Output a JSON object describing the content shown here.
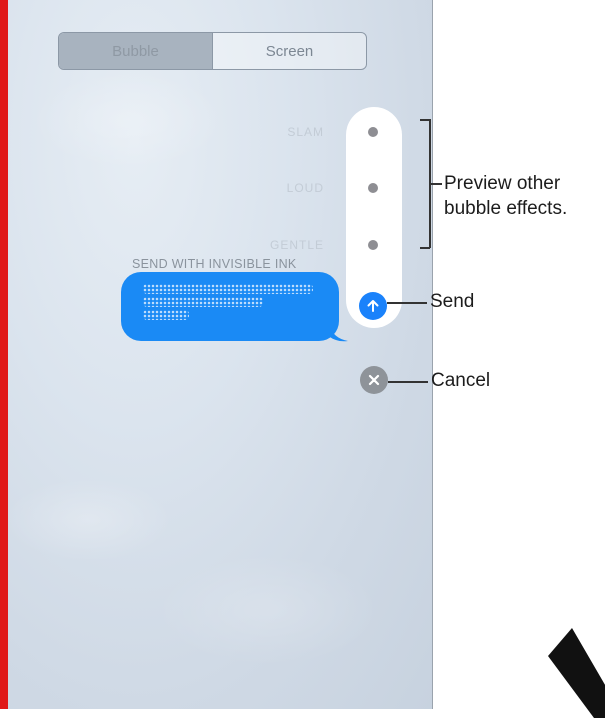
{
  "segmented_control": {
    "bubble_label": "Bubble",
    "screen_label": "Screen"
  },
  "effects": {
    "slam": "SLAM",
    "loud": "LOUD",
    "gentle": "GENTLE"
  },
  "message": {
    "caption": "SEND WITH INVISIBLE INK"
  },
  "annotations": {
    "preview_line1": "Preview other",
    "preview_line2": "bubble effects.",
    "send": "Send",
    "cancel": "Cancel"
  },
  "colors": {
    "accent": "#1a82fb",
    "bubble": "#1a8af5",
    "red_edge": "#e01818"
  }
}
